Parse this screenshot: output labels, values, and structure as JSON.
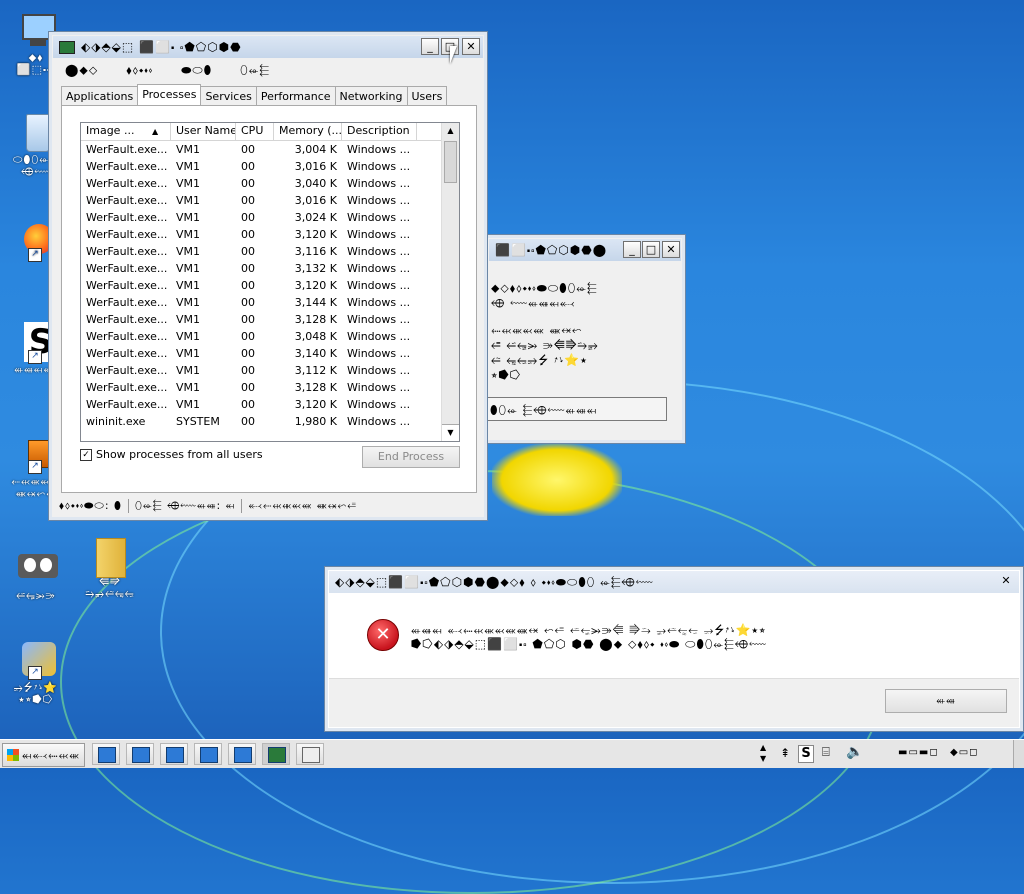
{
  "desktop": {
    "icons": [
      {
        "label": "⬥⬧\n⬜⬚⬝⬞⬝",
        "kind": "computer"
      },
      {
        "label": "⬭⬮⬯⬰⬱\n⬲⬳",
        "kind": "recycle"
      },
      {
        "label": "",
        "kind": "firefox"
      },
      {
        "label": "⬴⬵⬶⬷",
        "kind": "s-app"
      },
      {
        "label": "⬸⬹⬺⬻⬼\n⬽⬾⬿⭀",
        "kind": "tool"
      },
      {
        "label": "⭁⭂⭃⭄",
        "kind": "eyes"
      },
      {
        "label": "⭅⭆\n⭇⭈⭉⭊⭋",
        "kind": "folder"
      },
      {
        "label": "⭌⭍⭎⭏⭐\n⭑⭒⭓⭔",
        "kind": "shield"
      }
    ]
  },
  "taskmgr": {
    "title": "⬖⬗⬘⬙⬚ ⬛⬜⬝ ⬞⬟⬠⬡⬢⬣",
    "menu": [
      "⬤⬥⬦",
      "⬧⬨⬩⬪⬫",
      "⬬⬭⬮",
      "⬯⬰⬱"
    ],
    "tabs": [
      "Applications",
      "Processes",
      "Services",
      "Performance",
      "Networking",
      "Users"
    ],
    "columns": [
      "Image ...",
      "User Name",
      "CPU",
      "Memory (...",
      "Description"
    ],
    "rows": [
      [
        "WerFault.exe...",
        "VM1",
        "00",
        "3,004 K",
        "Windows ..."
      ],
      [
        "WerFault.exe...",
        "VM1",
        "00",
        "3,016 K",
        "Windows ..."
      ],
      [
        "WerFault.exe...",
        "VM1",
        "00",
        "3,040 K",
        "Windows ..."
      ],
      [
        "WerFault.exe...",
        "VM1",
        "00",
        "3,016 K",
        "Windows ..."
      ],
      [
        "WerFault.exe...",
        "VM1",
        "00",
        "3,024 K",
        "Windows ..."
      ],
      [
        "WerFault.exe...",
        "VM1",
        "00",
        "3,120 K",
        "Windows ..."
      ],
      [
        "WerFault.exe...",
        "VM1",
        "00",
        "3,116 K",
        "Windows ..."
      ],
      [
        "WerFault.exe...",
        "VM1",
        "00",
        "3,132 K",
        "Windows ..."
      ],
      [
        "WerFault.exe...",
        "VM1",
        "00",
        "3,120 K",
        "Windows ..."
      ],
      [
        "WerFault.exe...",
        "VM1",
        "00",
        "3,144 K",
        "Windows ..."
      ],
      [
        "WerFault.exe...",
        "VM1",
        "00",
        "3,128 K",
        "Windows ..."
      ],
      [
        "WerFault.exe...",
        "VM1",
        "00",
        "3,048 K",
        "Windows ..."
      ],
      [
        "WerFault.exe...",
        "VM1",
        "00",
        "3,140 K",
        "Windows ..."
      ],
      [
        "WerFault.exe...",
        "VM1",
        "00",
        "3,112 K",
        "Windows ..."
      ],
      [
        "WerFault.exe...",
        "VM1",
        "00",
        "3,128 K",
        "Windows ..."
      ],
      [
        "WerFault.exe...",
        "VM1",
        "00",
        "3,120 K",
        "Windows ..."
      ],
      [
        "wininit.exe",
        "SYSTEM",
        "00",
        "1,980 K",
        "Windows ..."
      ]
    ],
    "show_all_label": "Show processes from all users",
    "end_process_label": "End Process",
    "status": [
      "⬧⬨⬩⬪⬫⬬⬭: ⬮",
      "⬯⬰⬱ ⬲⬳⬴⬵: ⬶",
      "⬷⬸⬹⬺⬻⬼ ⬽⬾⬿⭀"
    ]
  },
  "bgdialog": {
    "title": "⬛⬜⬝⬞⬟⬠⬡⬢⬣⬤",
    "lines": [
      "⬥⬦⬧⬨⬩⬪⬫⬬⬭⬮⬯⬰⬱",
      "⬲ ⬳⬴⬵⬶⬷",
      "⬸⬹⬺⬻⬼ ⬽⬾⬿",
      "⭀ ⭁⭂⭃ ⭄⭅⭆⭇⭈",
      "⭉ ⭊⭋⭌⭍ ⭎⭏⭐⭑",
      "⭒⭓⭔"
    ],
    "field": "⬮⬯⬰ ⬱⬲⬳⬴⬵⬶"
  },
  "errdialog": {
    "title": "⬖⬗⬘⬙⬚⬛⬜⬝⬞⬟⬠⬡⬢⬣⬤⬥⬦⬧ ⬨ ⬩⬪⬫⬬⬭⬮⬯ ⬰⬱⬲⬳",
    "message_line1": "⬴⬵⬶ ⬷⬸⬹⬺⬻⬼⬽⬾ ⬿⭀ ⭁⭂⭃⭄⭅ ⭆⭇ ⭈⭉⭊⭋ ⭌⭍⭎⭏⭐⭑⭒",
    "message_line2": "⭓⭔⬖⬗⬘⬙⬚⬛⬜⬝⬞ ⬟⬠⬡ ⬢⬣ ⬤⬥ ⬦⬧⬨⬩ ⬪⬫⬬ ⬭⬮⬯⬰⬱⬲⬳",
    "ok_label": "⬴⬵"
  },
  "taskbar": {
    "start_label": "⬶⬷⬸⬹⬺"
  },
  "colors": {
    "accent": "#2a86de",
    "error": "#c8141e"
  }
}
